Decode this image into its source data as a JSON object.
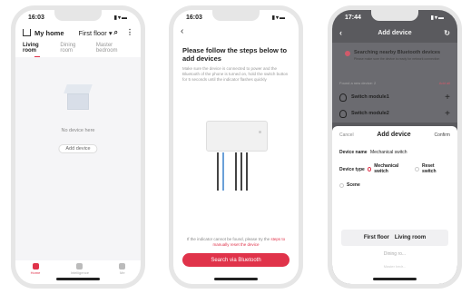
{
  "screen1": {
    "time": "16:03",
    "home_title": "My home",
    "floor": "First floor",
    "tabs": [
      "Living room",
      "Dining room",
      "Master bedroom"
    ],
    "empty_text": "No device here",
    "add_device": "Add device",
    "tabbar": [
      "Home",
      "Intelligence",
      "Me"
    ]
  },
  "screen2": {
    "time": "16:03",
    "title": "Please follow the steps below to add devices",
    "description": "Make sure the device is connected to power and the Bluetooth of the phone is turned on, hold the switch button for 5 seconds until the indicator flashes quickly",
    "note_pre": "If the indicator cannot be found, please try the",
    "note_link": "steps to manually reset the device",
    "button": "Search via Bluetooth"
  },
  "screen3": {
    "time": "17:44",
    "title": "Add device",
    "scanning": "Searching nearby Bluetooth devices",
    "scanning_sub": "Please make sure the device is ready for network connection",
    "found": "Found a new device: 2",
    "add_all": "Add all",
    "switches": [
      "Switch module1",
      "Switch module2"
    ],
    "sheet": {
      "cancel": "Cancel",
      "title": "Add device",
      "confirm": "Confirm",
      "name_label": "Device name",
      "name_value": "Mechanical switch",
      "type_label": "Device type",
      "type_options": [
        "Mechanical switch",
        "Reset switch"
      ],
      "scene": "Scene",
      "picker_floor": "First floor",
      "picker_room": "Living room",
      "picker_next": "Dining ro...",
      "picker_last": "Master bedr..."
    }
  },
  "colors": {
    "accent": "#e0334a",
    "overlay": "#5a5a5e"
  }
}
